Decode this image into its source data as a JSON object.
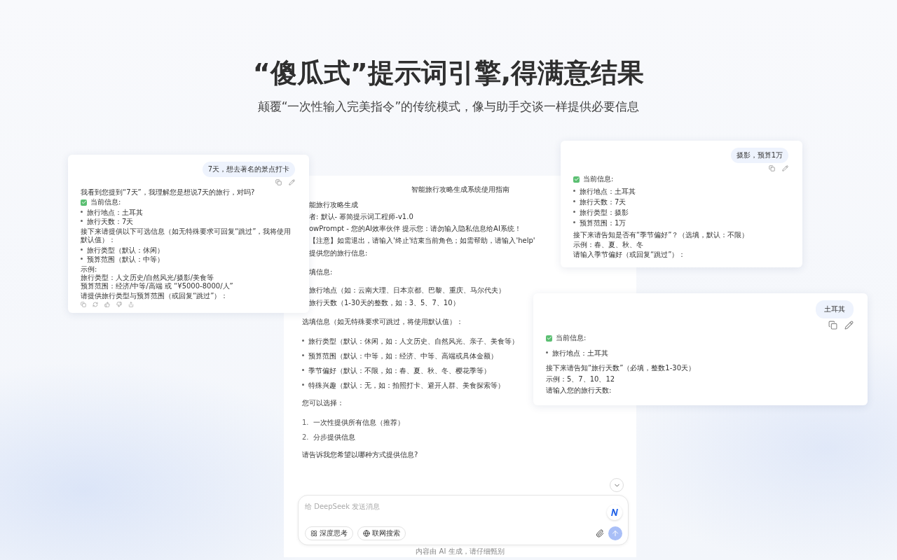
{
  "heading": {
    "title": "“傻瓜式”提示词引擎,得满意结果",
    "subtitle": "颠覆“一次性输入完美指令”的传统模式，像与助手交谈一样提供必要信息"
  },
  "main_chat": {
    "title": "智能旅行攻略生成系统使用指南",
    "content": [
      {
        "kind": "partial",
        "text": "能旅行攻略生成",
        "tight": true
      },
      {
        "kind": "partial",
        "text": "者: 默认- 幂简提示词工程师-v1.0",
        "tight": true
      },
      {
        "kind": "partial",
        "text": "owPrompt - 您的AI效率伙伴 提示您：请勿输入隐私信息给AI系统！",
        "tight": true
      },
      {
        "kind": "partial",
        "text": "【注意】如需退出，请输入'终止'结束当前角色；如需帮助，请输入'help'",
        "tight": true
      },
      {
        "kind": "partial",
        "text": "提供您的旅行信息:"
      },
      {
        "kind": "partial",
        "text": "填信息:"
      },
      {
        "kind": "partial",
        "text": "旅行地点（如：云南大理、日本京都、巴黎、重庆、马尔代夫）",
        "tight": true
      },
      {
        "kind": "partial",
        "text": "旅行天数（1-30天的整数，如：3、5、7、10）"
      },
      {
        "kind": "para",
        "text": "选填信息（如无特殊要求可跳过，将使用默认值）："
      },
      {
        "kind": "bullets",
        "items": [
          "旅行类型（默认：休闲，如：人文历史、自然风光、亲子、美食等）",
          "预算范围（默认：中等，如：经济、中等、高端或具体金额）",
          "季节偏好（默认：不限，如：春、夏、秋、冬、樱花季等）",
          "特殊兴趣（默认：无，如：拍照打卡、避开人群、美食探索等）"
        ]
      },
      {
        "kind": "para",
        "text": "您可以选择："
      },
      {
        "kind": "numbered",
        "items": [
          {
            "number": "1.",
            "text": "一次性提供所有信息（推荐）"
          },
          {
            "number": "2.",
            "text": "分步提供信息"
          }
        ]
      },
      {
        "kind": "para",
        "text": "请告诉我您希望以哪种方式提供信息?"
      }
    ],
    "composer": {
      "placeholder": "给 DeepSeek 发送消息",
      "buttons": [
        {
          "label": "深度思考"
        },
        {
          "label": "联网搜索"
        }
      ]
    },
    "footer_note": "内容由 AI 生成，请仔细甄别"
  },
  "chat_cards": [
    {
      "user_message": "7天，想去著名的景点打卡",
      "show_feedback": true,
      "reply": [
        {
          "kind": "para",
          "text": "我看到您提到“7天”，我理解您是想说7天的旅行，对吗?"
        },
        {
          "kind": "status",
          "text": "当前信息:"
        },
        {
          "kind": "bullets",
          "items": [
            "旅行地点：土耳其",
            "旅行天数：7天"
          ]
        },
        {
          "kind": "para",
          "text": "接下来请提供以下可选信息（如无特殊要求可回复“跳过”，我将使用默认值）："
        },
        {
          "kind": "bullets",
          "items": [
            "旅行类型（默认：休闲）",
            "预算范围（默认：中等）"
          ]
        },
        {
          "kind": "lines",
          "items": [
            "示例:",
            "旅行类型：人文历史/自然风光/摄影/美食等",
            "预算范围：经济/中等/高端 或 “¥5000-8000/人”"
          ]
        },
        {
          "kind": "para",
          "text": "请提供旅行类型与预算范围（或回复“跳过”）："
        }
      ]
    },
    {
      "user_message": "摄影，预算1万",
      "reply": [
        {
          "kind": "status",
          "text": "当前信息:"
        },
        {
          "kind": "bullets",
          "items": [
            "旅行地点：土耳其",
            "旅行天数：7天",
            "旅行类型：摄影",
            "预算范围：1万"
          ]
        },
        {
          "kind": "lines",
          "items": [
            "接下来请告知是否有“季节偏好”？（选填，默认：不限）",
            "示例：春、夏、秋、冬",
            "请输入季节偏好（或回复“跳过”）："
          ]
        }
      ]
    },
    {
      "user_message": "土耳其",
      "reply": [
        {
          "kind": "status",
          "text": "当前信息:"
        },
        {
          "kind": "bullets",
          "items": [
            "旅行地点：土耳其"
          ]
        },
        {
          "kind": "lines",
          "items": [
            "接下来请告知“旅行天数”（必填，整数1-30天）",
            "示例：5、7、10、12",
            "请输入您的旅行天数:"
          ]
        }
      ]
    }
  ]
}
